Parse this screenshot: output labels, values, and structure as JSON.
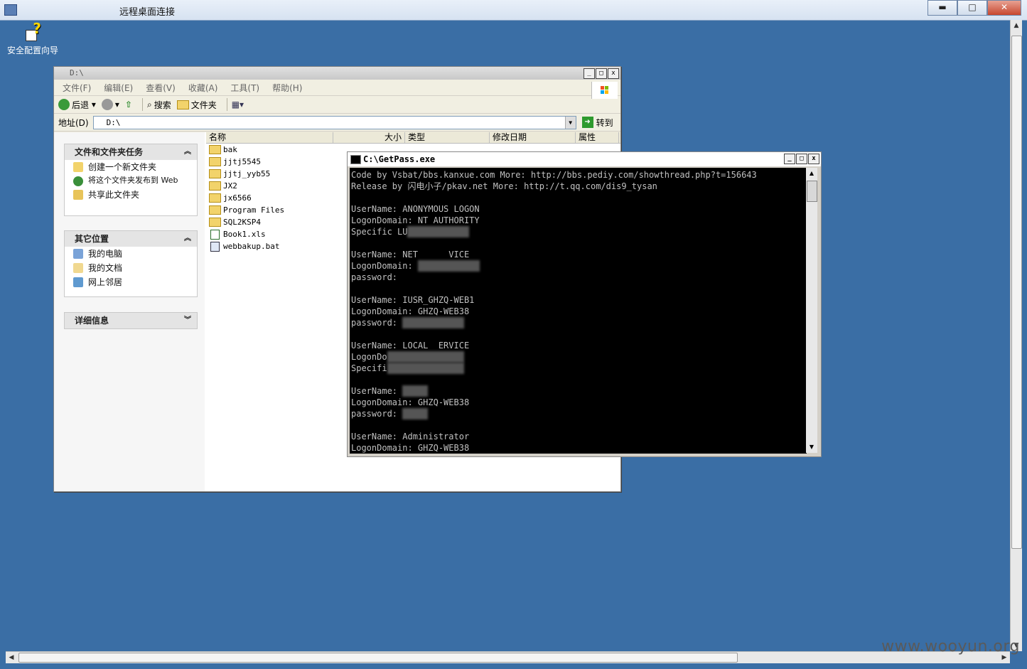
{
  "rdp": {
    "title": "远程桌面连接",
    "btn_min": "▬",
    "btn_max": "□",
    "btn_close": "✕"
  },
  "desktop_icon": {
    "label": "安全配置向导"
  },
  "watermark": "www.wooyun.org",
  "explorer": {
    "title": "D:\\",
    "menu": [
      "文件(F)",
      "编辑(E)",
      "查看(V)",
      "收藏(A)",
      "工具(T)",
      "帮助(H)"
    ],
    "toolbar": {
      "back": "后退",
      "search": "搜索",
      "folders": "文件夹"
    },
    "address_label": "地址(D)",
    "address_value": "D:\\",
    "go_label": "转到",
    "tasks_panel": {
      "title": "文件和文件夹任务",
      "items": [
        "创建一个新文件夹",
        "将这个文件夹发布到 Web",
        "共享此文件夹"
      ]
    },
    "places_panel": {
      "title": "其它位置",
      "items": [
        "我的电脑",
        "我的文档",
        "网上邻居"
      ]
    },
    "details_panel": {
      "title": "详细信息"
    },
    "columns": {
      "name": "名称",
      "size": "大小",
      "type": "类型",
      "modified": "修改日期",
      "attr": "属性"
    },
    "files": [
      "bak",
      "jjtj5545",
      "jjtj_yyb55",
      "JX2",
      "jx6566",
      "Program Files",
      "SQL2KSP4",
      "Book1.xls",
      "webbakup.bat"
    ]
  },
  "console": {
    "title": "C:\\GetPass.exe",
    "lines": [
      "Code by Vsbat/bbs.kanxue.com More: http://bbs.pediy.com/showthread.php?t=156643",
      "Release by 闪电小子/pkav.net More: http://t.qq.com/dis9_tysan",
      "",
      "UserName: ANONYMOUS LOGON",
      "LogonDomain: NT AUTHORITY",
      "Specific LU",
      "",
      "UserName: NET      VICE",
      "LogonDomain:",
      "password:",
      "",
      "UserName: IUSR_GHZQ-WEB1",
      "LogonDomain: GHZQ-WEB38",
      "password:",
      "",
      "UserName: LOCAL  ERVICE",
      "LogonDo",
      "Specifi",
      "",
      "UserName:",
      "LogonDomain: GHZQ-WEB38",
      "password:",
      "",
      "UserName: Administrator",
      "LogonDomain: GHZQ-WEB38"
    ]
  }
}
